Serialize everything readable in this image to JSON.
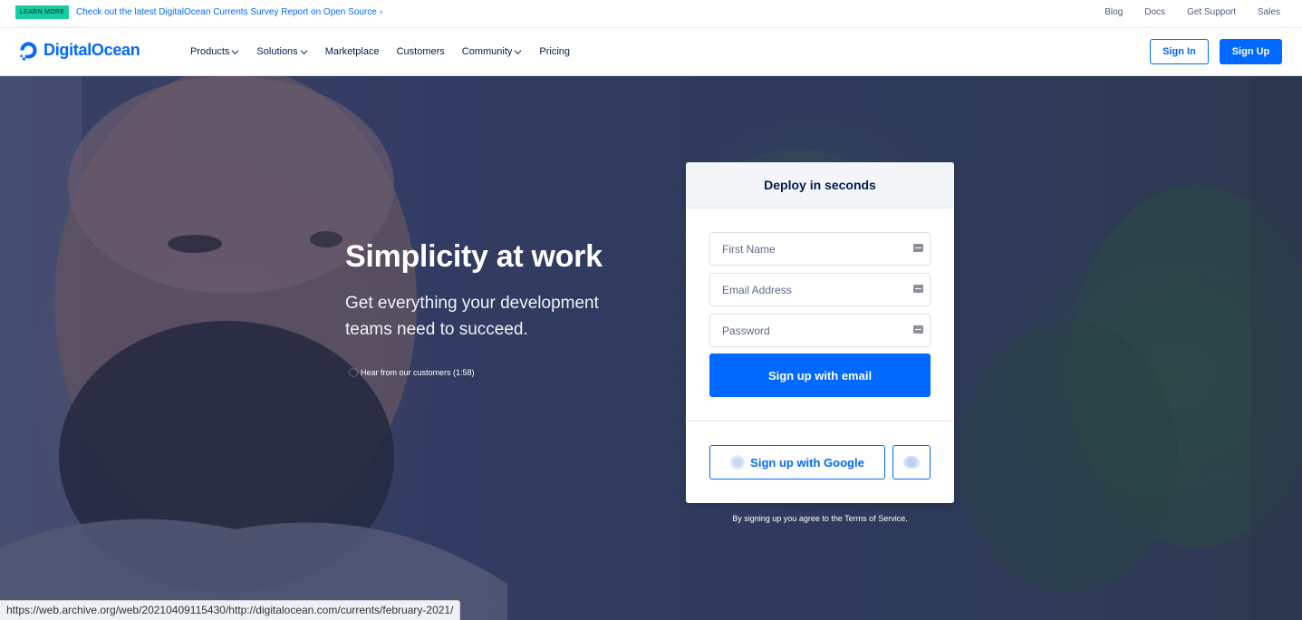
{
  "topbar": {
    "badge": "LEARN MORE",
    "announcement": "Check out the latest DigitalOcean Currents Survey Report on Open Source",
    "links": [
      "Blog",
      "Docs",
      "Get Support",
      "Sales"
    ]
  },
  "nav": {
    "logo_text": "DigitalOcean",
    "items": [
      {
        "label": "Products",
        "dropdown": true
      },
      {
        "label": "Solutions",
        "dropdown": true
      },
      {
        "label": "Marketplace",
        "dropdown": false
      },
      {
        "label": "Customers",
        "dropdown": false
      },
      {
        "label": "Community",
        "dropdown": true
      },
      {
        "label": "Pricing",
        "dropdown": false
      }
    ],
    "signin_label": "Sign In",
    "signup_label": "Sign Up"
  },
  "hero": {
    "title": "Simplicity at work",
    "subtitle": "Get everything your development teams need to succeed.",
    "video_link": "Hear from our customers (1:58)"
  },
  "signup_card": {
    "heading": "Deploy in seconds",
    "first_name_placeholder": "First Name",
    "email_placeholder": "Email Address",
    "password_placeholder": "Password",
    "email_button": "Sign up with email",
    "google_button": "Sign up with Google",
    "terms": "By signing up you agree to the Terms of Service."
  },
  "statusbar": {
    "url": "https://web.archive.org/web/20210409115430/http://digitalocean.com/currents/february-2021/"
  },
  "colors": {
    "brand_blue": "#0069ff",
    "navy_text": "#031b4e",
    "badge_green": "#15cd9f"
  }
}
